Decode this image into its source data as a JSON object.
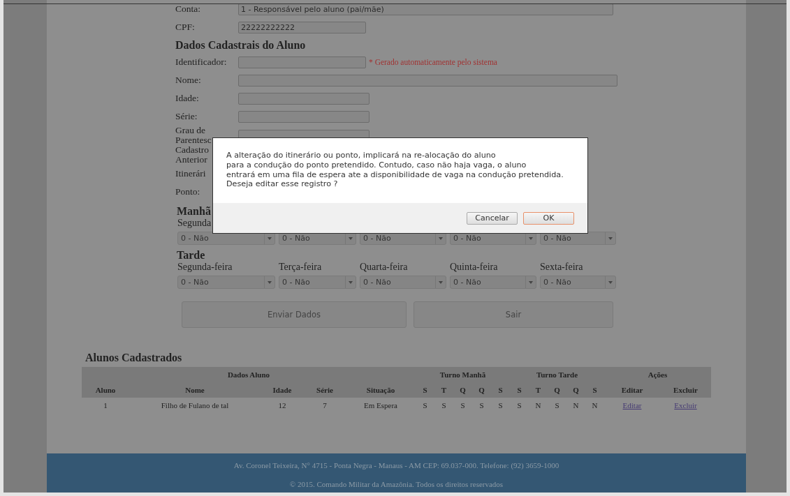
{
  "form": {
    "fields": [
      {
        "label": "Conta:",
        "kind": "long",
        "value": "1 - Responsável pelo aluno (pai/mãe)"
      },
      {
        "label": "CPF:",
        "kind": "short",
        "value": "22222222222"
      }
    ],
    "section_title": "Dados Cadastrais do Aluno",
    "student_fields": [
      {
        "label": "Identificador:",
        "kind": "short",
        "note": "* Gerado automaticamente pelo sistema"
      },
      {
        "label": "Nome:",
        "kind": "wide"
      },
      {
        "label": "Idade:",
        "kind": "medium"
      },
      {
        "label": "Série:",
        "kind": "medium"
      },
      {
        "label": "Grau de Parentesc",
        "kind": "medium"
      },
      {
        "label": "Cadastro Anterior",
        "kind": "hidden"
      },
      {
        "label": "Itinerári",
        "kind": "hidden"
      },
      {
        "label": "Ponto:",
        "kind": "hidden"
      }
    ],
    "shifts": [
      {
        "title": "Manhã",
        "days": [
          {
            "label": "Segunda",
            "value": "0 - Não"
          },
          {
            "value": "0 - Não"
          },
          {
            "value": "0 - Não"
          },
          {
            "value": "0 - Não"
          },
          {
            "value": "0 - Não"
          }
        ]
      },
      {
        "title": "Tarde",
        "days": [
          {
            "label": "Segunda-feira",
            "value": "0 - Não"
          },
          {
            "label": "Terça-feira",
            "value": "0 - Não"
          },
          {
            "label": "Quarta-feira",
            "value": "0 - Não"
          },
          {
            "label": "Quinta-feira",
            "value": "0 - Não"
          },
          {
            "label": "Sexta-feira",
            "value": "0 - Não"
          }
        ]
      }
    ],
    "buttons": [
      "Enviar Dados",
      "Sair"
    ]
  },
  "table": {
    "title": "Alunos Cadastrados",
    "group_headers": [
      "Dados Aluno",
      "Turno Manhã",
      "Turno Tarde",
      "Ações"
    ],
    "columns": [
      "Aluno",
      "Nome",
      "Idade",
      "Série",
      "Situação",
      "S",
      "T",
      "Q",
      "Q",
      "S",
      "S",
      "T",
      "Q",
      "Q",
      "S",
      "Editar",
      "Excluir"
    ],
    "rows": [
      {
        "cells": [
          "1",
          "Filho de Fulano de tal",
          "12",
          "7",
          "Em Espera",
          "S",
          "S",
          "S",
          "S",
          "S",
          "S",
          "N",
          "S",
          "N",
          "N"
        ],
        "links": [
          "Editar",
          "Excluir"
        ]
      }
    ]
  },
  "footer": {
    "address": "Av. Coronel Teixeira, N° 4715 - Ponta Negra - Manaus - AM CEP: 69.037-000. Telefone: (92) 3659-1000",
    "copyright": "© 2015. Comando Militar da Amazônia. Todos os direitos reservados"
  },
  "dialog": {
    "lines": [
      "A alteração do itinerário ou ponto, implicará na re-alocação do aluno",
      "para a condução do ponto pretendido. Contudo, caso não haja vaga, o aluno",
      "entrará em uma fila de espera ate a disponibilidade de vaga na condução pretendida.",
      "Deseja editar esse registro ?"
    ],
    "buttons": [
      {
        "label": "Cancelar",
        "kind": "default"
      },
      {
        "label": "OK",
        "kind": "primary"
      }
    ]
  }
}
